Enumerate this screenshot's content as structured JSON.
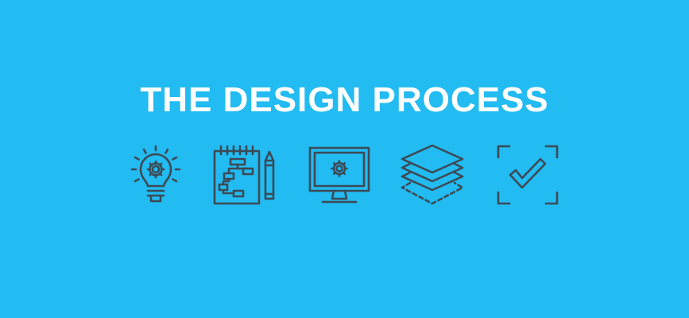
{
  "banner": {
    "title": "THE DESIGN PROCESS",
    "background_color": "#22bbf2",
    "title_color": "#ffffff",
    "icon_color": "#3d4a55"
  },
  "icons": [
    {
      "name": "lightbulb-gear-icon"
    },
    {
      "name": "flowchart-notepad-pencil-icon"
    },
    {
      "name": "monitor-gear-icon"
    },
    {
      "name": "layers-stack-icon"
    },
    {
      "name": "checkmark-frame-icon"
    }
  ]
}
